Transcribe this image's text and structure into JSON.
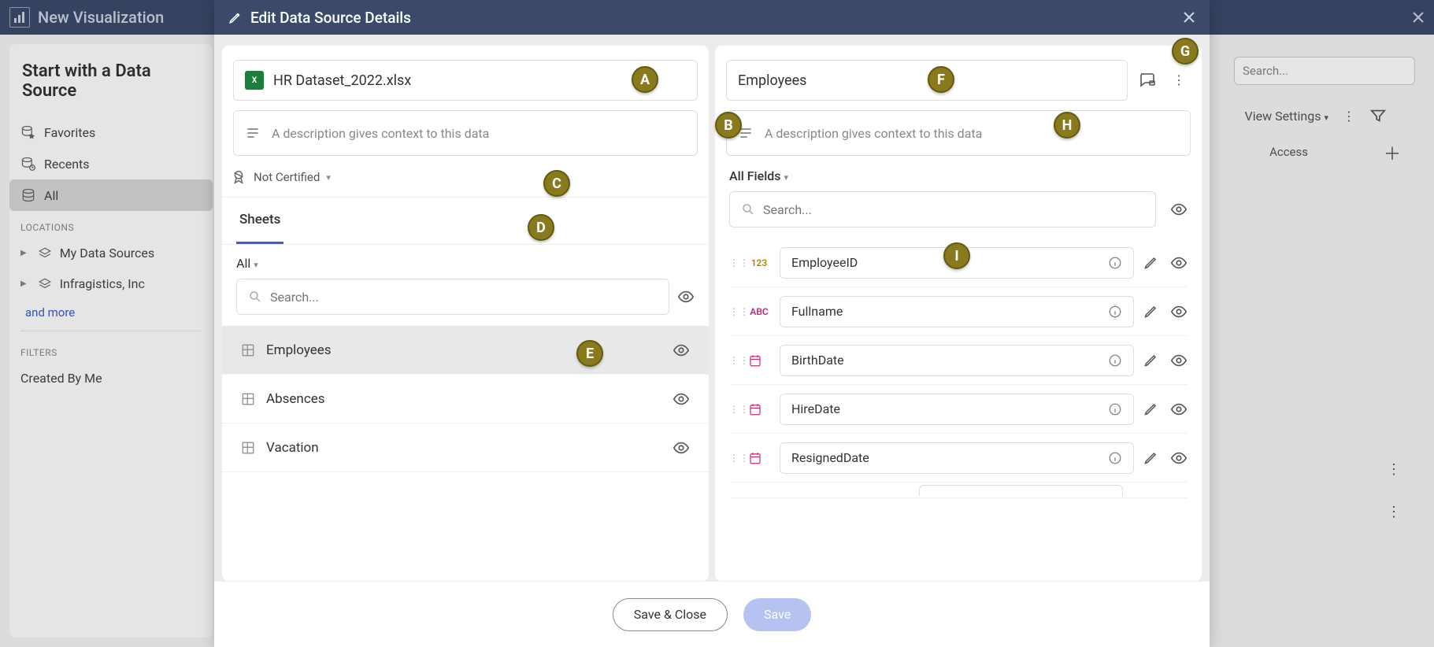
{
  "app": {
    "title": "New Visualization"
  },
  "sidebar": {
    "heading": "Start with a Data Source",
    "items": [
      {
        "label": "Favorites"
      },
      {
        "label": "Recents"
      },
      {
        "label": "All"
      }
    ],
    "locations_label": "LOCATIONS",
    "locations": [
      {
        "label": "My Data Sources"
      },
      {
        "label": "Infragistics, Inc"
      }
    ],
    "more_link": "and more",
    "filters_label": "FILTERS",
    "filters": [
      {
        "label": "Created By Me"
      }
    ]
  },
  "bg": {
    "search_placeholder": "Search...",
    "view_settings": "View Settings",
    "access_col": "Access"
  },
  "modal": {
    "title": "Edit Data Source Details",
    "file_name": "HR Dataset_2022.xlsx",
    "ds_desc_placeholder": "A description gives context to this data",
    "cert_label": "Not Certified",
    "tab_sheets": "Sheets",
    "all_label": "All",
    "sheet_search_placeholder": "Search...",
    "sheets": [
      {
        "label": "Employees",
        "selected": true
      },
      {
        "label": "Absences",
        "selected": false
      },
      {
        "label": "Vacation",
        "selected": false
      }
    ],
    "sheet_name": "Employees",
    "sheet_desc_placeholder": "A description gives context to this data",
    "all_fields_label": "All Fields",
    "field_search_placeholder": "Search...",
    "fields": [
      {
        "name": "EmployeeID",
        "type": "num",
        "badge": "123"
      },
      {
        "name": "Fullname",
        "type": "str",
        "badge": "ABC"
      },
      {
        "name": "BirthDate",
        "type": "date",
        "badge": ""
      },
      {
        "name": "HireDate",
        "type": "date",
        "badge": ""
      },
      {
        "name": "ResignedDate",
        "type": "date",
        "badge": ""
      }
    ],
    "save_close": "Save & Close",
    "save": "Save"
  },
  "callouts": [
    "A",
    "B",
    "C",
    "D",
    "E",
    "F",
    "G",
    "H",
    "I"
  ]
}
